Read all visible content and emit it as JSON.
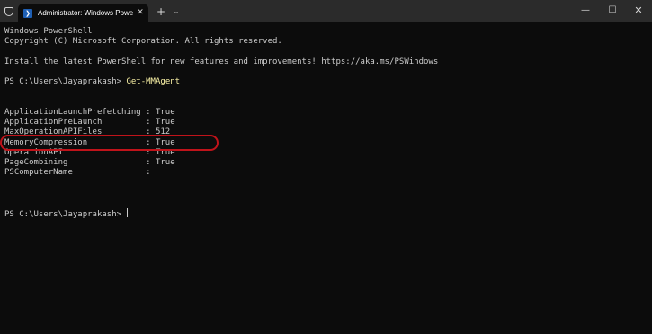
{
  "titlebar": {
    "shield_icon": "shield-icon",
    "tab_icon": "powershell-icon",
    "tab_icon_glyph": "❯",
    "tab_title": "Administrator: Windows Powe",
    "tab_close": "✕",
    "new_tab": "+",
    "dropdown": "⌄",
    "minimize": "—",
    "maximize": "☐",
    "close": "✕"
  },
  "terminal": {
    "lines": [
      "Windows PowerShell",
      "Copyright (C) Microsoft Corporation. All rights reserved.",
      "Install the latest PowerShell for new features and improvements! https://aka.ms/PSWindows"
    ],
    "prompt": "PS C:\\Users\\Jayaprakash> ",
    "command": "Get-MMAgent",
    "output": [
      "ApplicationLaunchPrefetching : True",
      "ApplicationPreLaunch         : True",
      "MaxOperationAPIFiles         : 512",
      "MemoryCompression            : True",
      "OperationAPI                 : True",
      "PageCombining                : True",
      "PSComputerName               :"
    ],
    "final_prompt": "PS C:\\Users\\Jayaprakash> "
  },
  "colors": {
    "background": "#0c0c0c",
    "titlebar": "#2b2b2b",
    "text": "#cccccc",
    "command": "#f9f1a5",
    "highlight": "#c0131a"
  }
}
